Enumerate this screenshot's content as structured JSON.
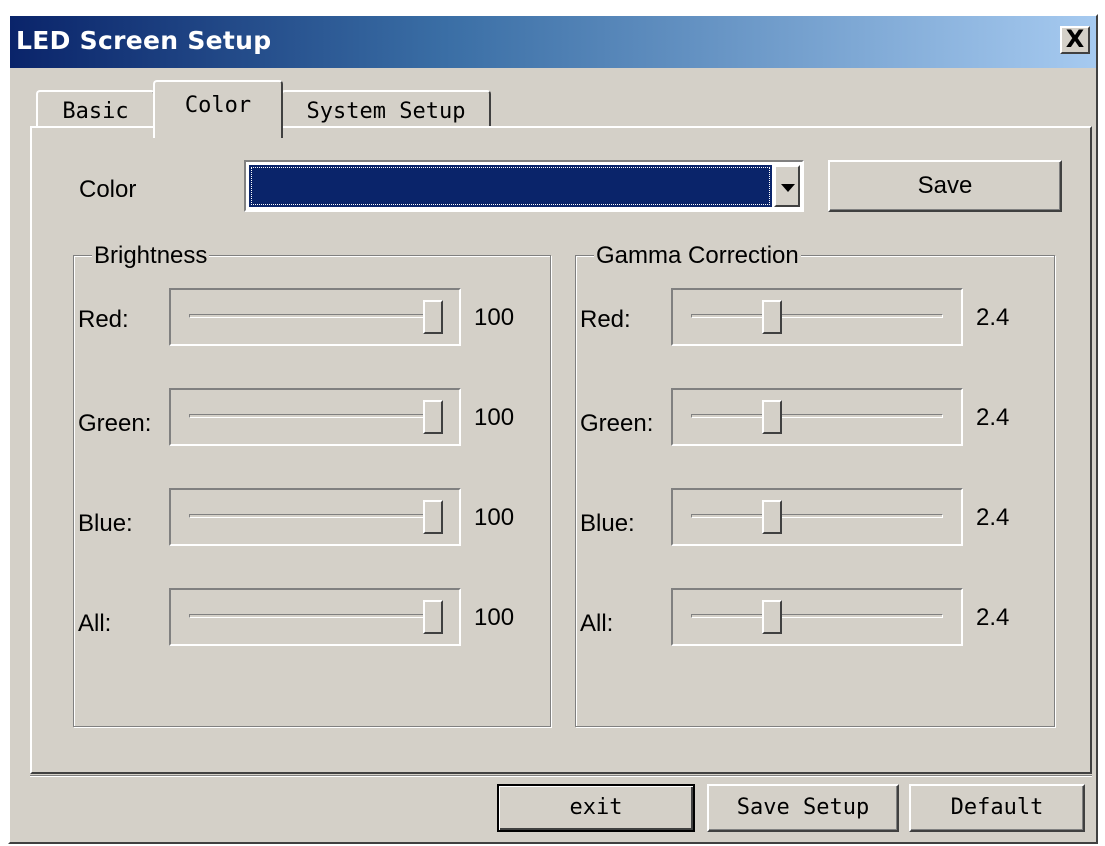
{
  "window": {
    "title": "LED Screen Setup",
    "close_label": "X"
  },
  "tabs": [
    {
      "label": "Basic",
      "active": false
    },
    {
      "label": "Color",
      "active": true
    },
    {
      "label": "System Setup",
      "active": false
    }
  ],
  "color": {
    "label": "Color",
    "selected_swatch": "#0a246a",
    "save_label": "Save"
  },
  "brightness": {
    "legend": "Brightness",
    "rows": [
      {
        "label": "Red:",
        "value": "100",
        "level": 1.0
      },
      {
        "label": "Green:",
        "value": "100",
        "level": 1.0
      },
      {
        "label": "Blue:",
        "value": "100",
        "level": 1.0
      },
      {
        "label": "All:",
        "value": "100",
        "level": 1.0
      }
    ]
  },
  "gamma": {
    "legend": "Gamma Correction",
    "rows": [
      {
        "label": "Red:",
        "value": "2.4",
        "level": 0.33
      },
      {
        "label": "Green:",
        "value": "2.4",
        "level": 0.33
      },
      {
        "label": "Blue:",
        "value": "2.4",
        "level": 0.33
      },
      {
        "label": "All:",
        "value": "2.4",
        "level": 0.33
      }
    ]
  },
  "footer": {
    "exit_label": "exit",
    "save_setup_label": "Save Setup",
    "default_label": "Default"
  }
}
